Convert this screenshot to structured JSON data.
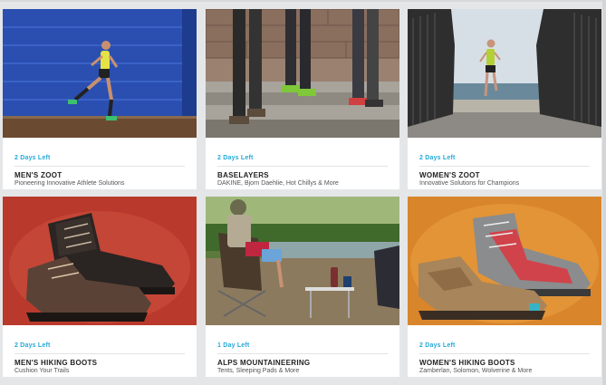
{
  "colors": {
    "accent": "#24a9d8",
    "title": "#222222",
    "subtitle": "#555555",
    "background": "#e5e6e8"
  },
  "cards": [
    {
      "days_left": "2 Days Left",
      "title": "MEN'S ZOOT",
      "subtitle": "Pioneering Innovative Athlete Solutions",
      "image_icon": "runner-blue-wall-image"
    },
    {
      "days_left": "2 Days Left",
      "title": "BASELAYERS",
      "subtitle": "DAKINE, Bjorn Daehlie, Hot Chillys & More",
      "image_icon": "legs-stone-steps-image"
    },
    {
      "days_left": "2 Days Left",
      "title": "WOMEN'S ZOOT",
      "subtitle": "Innovative Solutions for Champions",
      "image_icon": "woman-runner-bridge-image"
    },
    {
      "days_left": "2 Days Left",
      "title": "MEN'S HIKING BOOTS",
      "subtitle": "Cushion Your Trails",
      "image_icon": "hiking-boots-red-image"
    },
    {
      "days_left": "1 Day Left",
      "title": "ALPS MOUNTAINEERING",
      "subtitle": "Tents, Sleeping Pads & More",
      "image_icon": "camp-chairs-river-image"
    },
    {
      "days_left": "2 Days Left",
      "title": "WOMEN'S HIKING BOOTS",
      "subtitle": "Zamberlan, Solomon, Wolverine & More",
      "image_icon": "womens-boots-orange-image"
    }
  ]
}
